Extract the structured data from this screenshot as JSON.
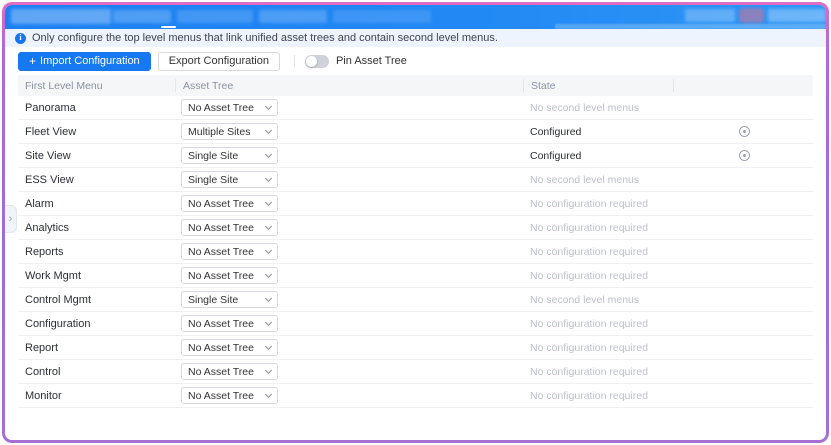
{
  "topbar": {
    "note": "redacted navigation items",
    "active_indicator": true
  },
  "banner": {
    "info_glyph": "i",
    "text": "Only configure the top level menus that link unified asset trees and contain second level menus."
  },
  "toolbar": {
    "import_icon": "+",
    "import_label": "Import Configuration",
    "export_label": "Export Configuration",
    "toggle_label": "Pin Asset Tree",
    "toggle_state": "off"
  },
  "expander_glyph": "›",
  "table": {
    "columns": [
      "First Level Menu",
      "Asset Tree",
      "State",
      ""
    ],
    "rows": [
      {
        "menu": "Panorama",
        "asset_tree": "No Asset Tree",
        "state": "No second level menus",
        "state_type": "muted",
        "has_action": false
      },
      {
        "menu": "Fleet View",
        "asset_tree": "Multiple Sites",
        "state": "Configured",
        "state_type": "normal",
        "has_action": true
      },
      {
        "menu": "Site View",
        "asset_tree": "Single Site",
        "state": "Configured",
        "state_type": "normal",
        "has_action": true
      },
      {
        "menu": "ESS View",
        "asset_tree": "Single Site",
        "state": "No second level menus",
        "state_type": "muted",
        "has_action": false
      },
      {
        "menu": "Alarm",
        "asset_tree": "No Asset Tree",
        "state": "No configuration required",
        "state_type": "muted",
        "has_action": false
      },
      {
        "menu": "Analytics",
        "asset_tree": "No Asset Tree",
        "state": "No configuration required",
        "state_type": "muted",
        "has_action": false
      },
      {
        "menu": "Reports",
        "asset_tree": "No Asset Tree",
        "state": "No configuration required",
        "state_type": "muted",
        "has_action": false
      },
      {
        "menu": "Work Mgmt",
        "asset_tree": "No Asset Tree",
        "state": "No configuration required",
        "state_type": "muted",
        "has_action": false
      },
      {
        "menu": "Control Mgmt",
        "asset_tree": "Single Site",
        "state": "No second level menus",
        "state_type": "muted",
        "has_action": false
      },
      {
        "menu": "Configuration",
        "asset_tree": "No Asset Tree",
        "state": "No configuration required",
        "state_type": "muted",
        "has_action": false
      },
      {
        "menu": "Report",
        "asset_tree": "No Asset Tree",
        "state": "No configuration required",
        "state_type": "muted",
        "has_action": false
      },
      {
        "menu": "Control",
        "asset_tree": "No Asset Tree",
        "state": "No configuration required",
        "state_type": "muted",
        "has_action": false
      },
      {
        "menu": "Monitor",
        "asset_tree": "No Asset Tree",
        "state": "No configuration required",
        "state_type": "muted",
        "has_action": false
      }
    ]
  },
  "colors": {
    "topbar_blue": "#1c80f2",
    "primary_button": "#1779f2",
    "banner_bg": "#edf4fe",
    "table_header_bg": "#f5f6f8",
    "muted_text": "#bcc1cb",
    "frame_border_purple": "#a06cd8",
    "frame_border_magenta": "#e06cc4"
  }
}
